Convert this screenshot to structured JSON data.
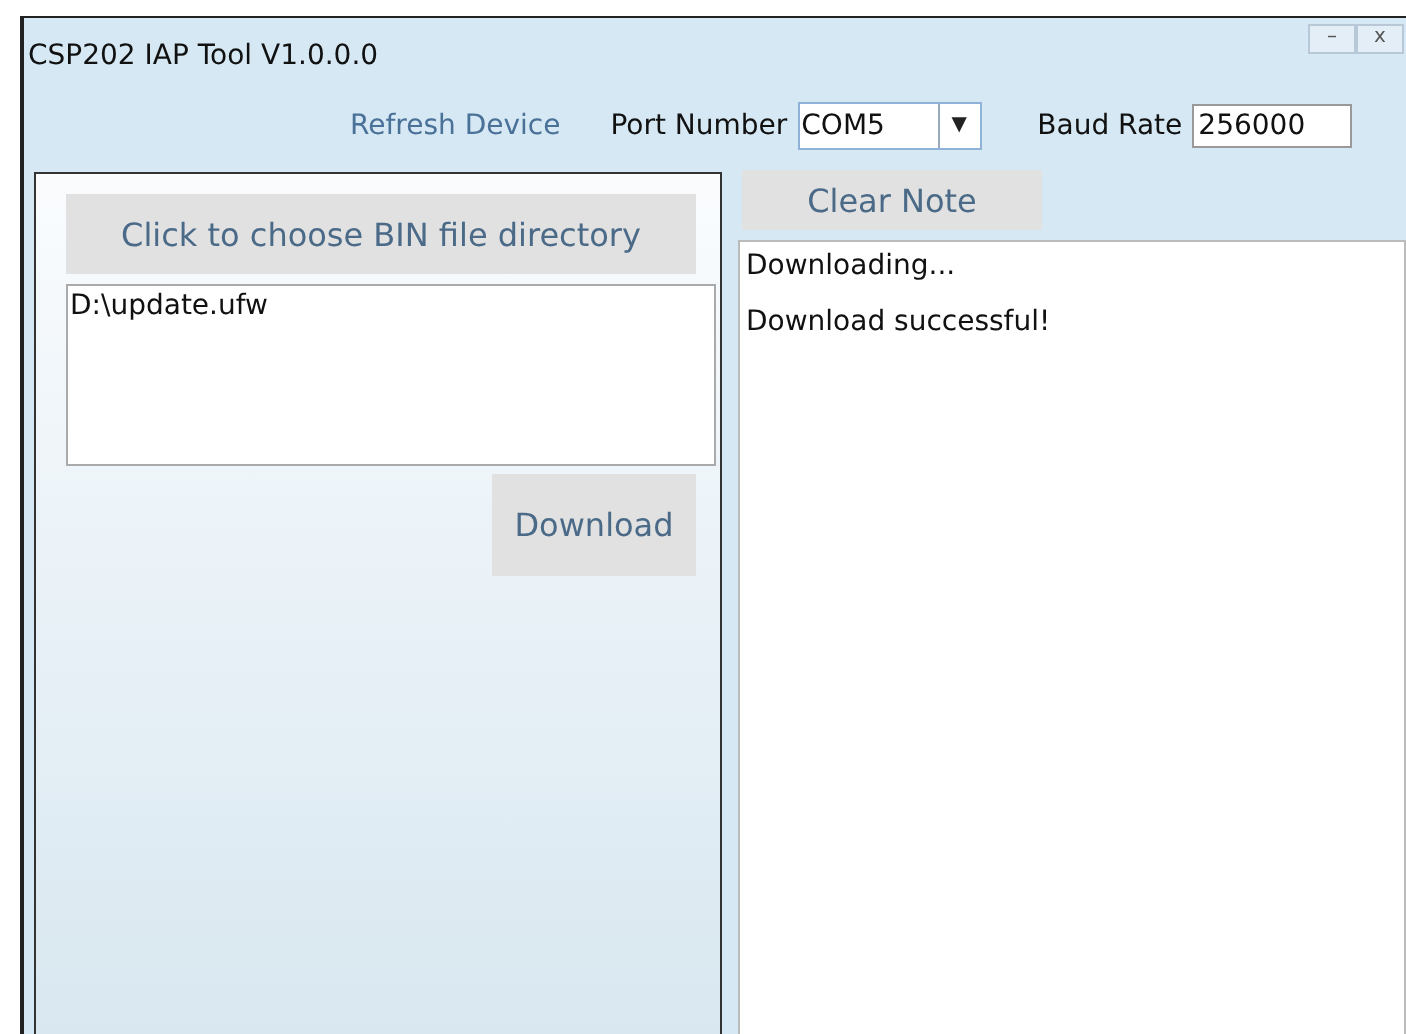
{
  "window": {
    "title": "CSP202 IAP Tool V1.0.0.0",
    "controls": [
      "–",
      "x"
    ]
  },
  "toolbar": {
    "refresh_label": "Refresh Device",
    "port_label": "Port Number",
    "port_value": "COM5",
    "port_arrow": "▼",
    "baud_label": "Baud Rate",
    "baud_value": "256000"
  },
  "file_panel": {
    "choose_button": "Click to choose BIN file directory",
    "file_path": "D:\\update.ufw",
    "download_button": "Download"
  },
  "note_panel": {
    "clear_button": "Clear Note",
    "log_lines": [
      "Downloading...",
      "Download successful!"
    ]
  }
}
